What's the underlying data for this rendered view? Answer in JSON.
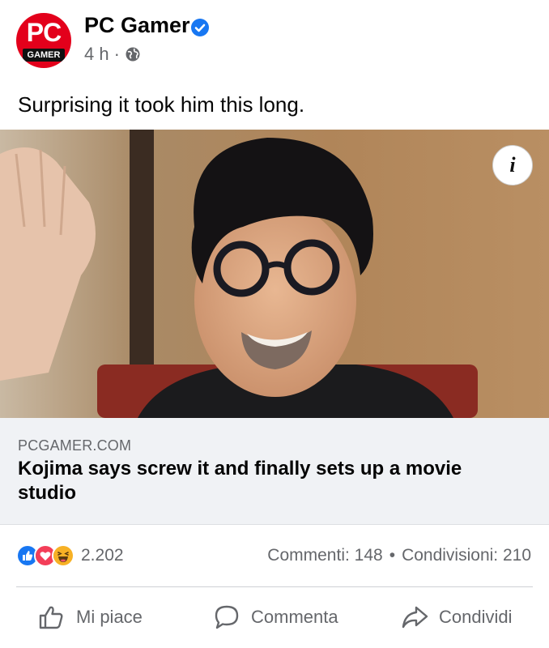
{
  "post": {
    "page_name": "PC Gamer",
    "avatar_text_top": "PC",
    "avatar_text_bottom": "GAMER",
    "time": "4 h",
    "separator": "·",
    "text": "Surprising it took him this long.",
    "verified_icon": "verified-badge-icon",
    "audience_icon": "globe-icon"
  },
  "image": {
    "description_icon": "info-icon",
    "info_label": "i"
  },
  "link": {
    "domain": "PCGAMER.COM",
    "title": "Kojima says screw it and finally sets up a movie studio"
  },
  "stats": {
    "reactions": [
      "like-reaction-icon",
      "love-reaction-icon",
      "haha-reaction-icon"
    ],
    "reaction_count": "2.202",
    "comments": "Commenti: 148",
    "dot": "•",
    "shares": "Condivisioni: 210"
  },
  "actions": {
    "like": "Mi piace",
    "comment": "Commenta",
    "share": "Condividi"
  },
  "colors": {
    "brand_red": "#e3001b",
    "facebook_blue": "#1877f2",
    "love_red": "#f33e58",
    "haha_yellow": "#f7b125",
    "secondary_text": "#65676b"
  }
}
